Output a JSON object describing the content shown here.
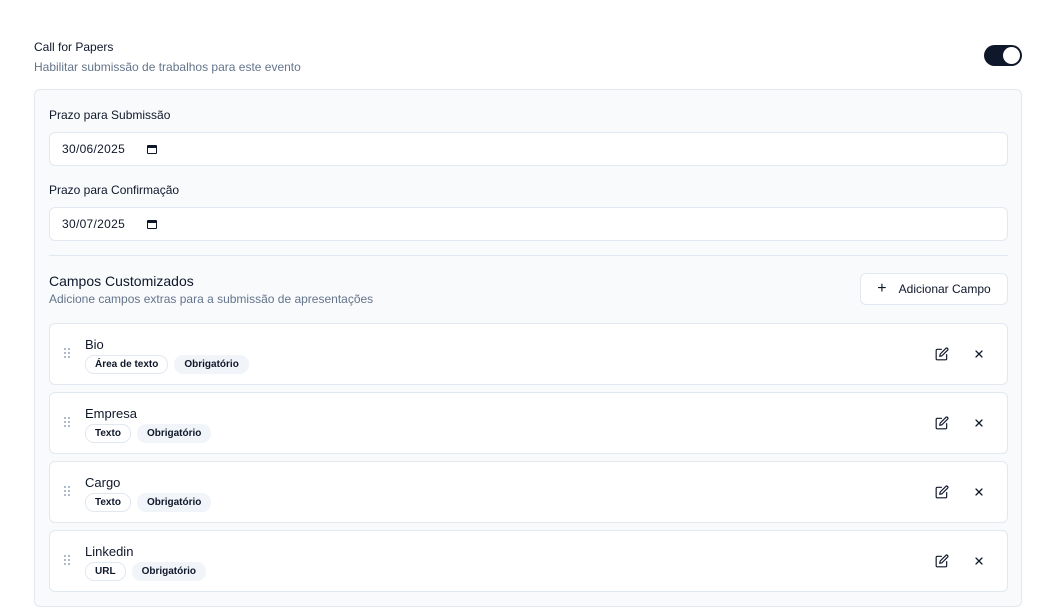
{
  "header": {
    "title": "Call for Papers",
    "description": "Habilitar submissão de trabalhos para este evento",
    "toggle_on": true
  },
  "deadlines": {
    "submission_label": "Prazo para Submissão",
    "submission_value": "30/06/2025",
    "confirmation_label": "Prazo para Confirmação",
    "confirmation_value": "30/07/2025"
  },
  "custom_fields": {
    "title": "Campos Customizados",
    "description": "Adicione campos extras para a submissão de apresentações",
    "add_button_label": "Adicionar Campo",
    "items": [
      {
        "name": "Bio",
        "type": "Área de texto",
        "required": "Obrigatório"
      },
      {
        "name": "Empresa",
        "type": "Texto",
        "required": "Obrigatório"
      },
      {
        "name": "Cargo",
        "type": "Texto",
        "required": "Obrigatório"
      },
      {
        "name": "Linkedin",
        "type": "URL",
        "required": "Obrigatório"
      }
    ]
  },
  "icons": {
    "drag": "grip-vertical-icon",
    "edit": "edit-icon",
    "delete": "close-icon",
    "add": "plus-icon",
    "calendar": "calendar-icon"
  },
  "colors": {
    "primary": "#0f172a",
    "muted": "#64748b",
    "border": "#e2e8f0",
    "panel_bg": "#f8fafc",
    "badge_bg": "#f1f5f9"
  }
}
